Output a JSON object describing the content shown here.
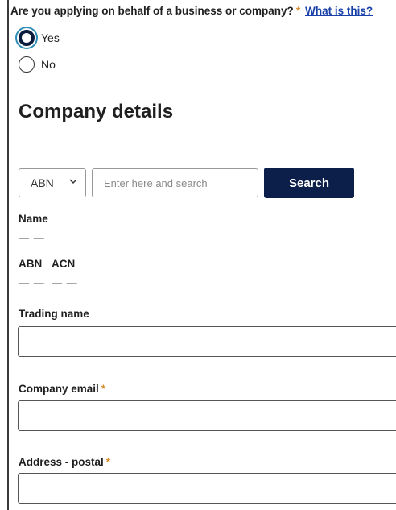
{
  "question": {
    "text": "Are you applying on behalf of a business or company?",
    "required_mark": "*",
    "help_link": "What is this?"
  },
  "radio_options": [
    {
      "label": "Yes",
      "selected": true
    },
    {
      "label": "No",
      "selected": false
    }
  ],
  "section_title": "Company details",
  "lookup": {
    "type_selected": "ABN",
    "search_placeholder": "Enter here and search",
    "search_value": "",
    "search_button": "Search"
  },
  "results": {
    "name_label": "Name",
    "name_value": "— —",
    "abn_label": "ABN",
    "acn_label": "ACN",
    "abn_value": "— —",
    "acn_value": "— —"
  },
  "fields": {
    "trading_name": {
      "label": "Trading name",
      "value": ""
    },
    "company_email": {
      "label": "Company email",
      "required_mark": "*",
      "value": ""
    },
    "address_postal": {
      "label": "Address - postal",
      "required_mark": "*",
      "value": ""
    }
  },
  "colors": {
    "primary_button": "#0c1f4a",
    "link": "#1840a8",
    "required_star": "#d98d2b",
    "focus_ring": "#2d8cb5"
  }
}
